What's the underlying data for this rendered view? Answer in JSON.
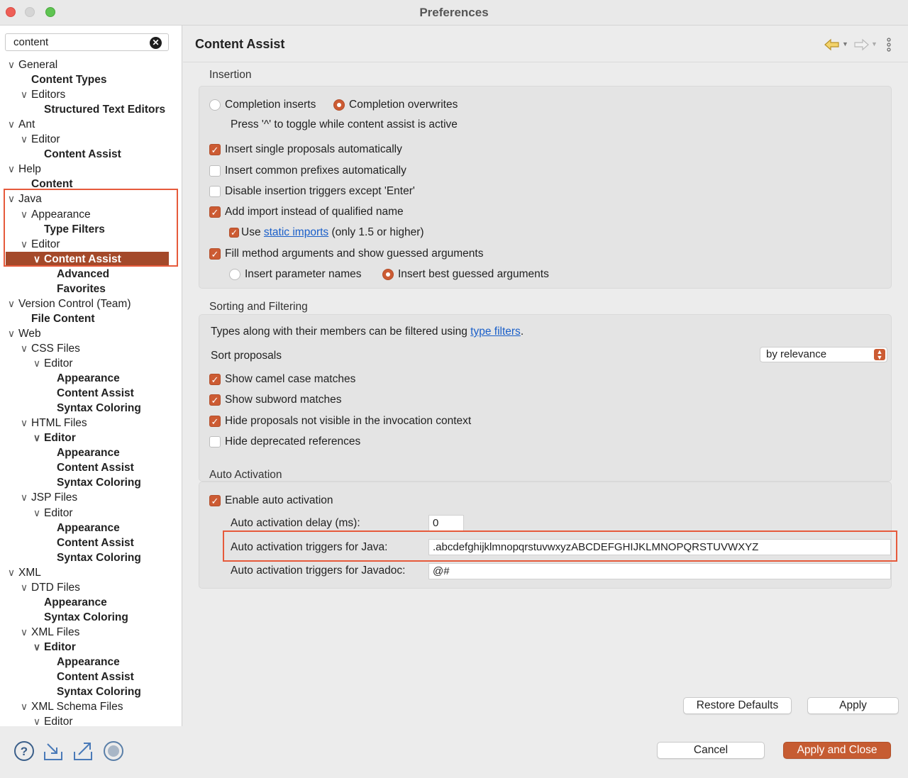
{
  "window": {
    "title": "Preferences"
  },
  "search": {
    "value": "content"
  },
  "tree": [
    {
      "label": "General",
      "level": 0,
      "expanded": true,
      "bold": false
    },
    {
      "label": "Content Types",
      "level": 1,
      "bold": true
    },
    {
      "label": "Editors",
      "level": 1,
      "expanded": true,
      "bold": false
    },
    {
      "label": "Structured Text Editors",
      "level": 2,
      "bold": true
    },
    {
      "label": "Ant",
      "level": 0,
      "expanded": true,
      "bold": false
    },
    {
      "label": "Editor",
      "level": 1,
      "expanded": true,
      "bold": false
    },
    {
      "label": "Content Assist",
      "level": 2,
      "bold": true
    },
    {
      "label": "Help",
      "level": 0,
      "expanded": true,
      "bold": false
    },
    {
      "label": "Content",
      "level": 1,
      "bold": true
    },
    {
      "label": "Java",
      "level": 0,
      "expanded": true,
      "bold": false
    },
    {
      "label": "Appearance",
      "level": 1,
      "expanded": true,
      "bold": false
    },
    {
      "label": "Type Filters",
      "level": 2,
      "bold": true
    },
    {
      "label": "Editor",
      "level": 1,
      "expanded": true,
      "bold": false
    },
    {
      "label": "Content Assist",
      "level": 2,
      "expanded": true,
      "bold": true,
      "selected": true
    },
    {
      "label": "Advanced",
      "level": 3,
      "bold": true
    },
    {
      "label": "Favorites",
      "level": 3,
      "bold": true
    },
    {
      "label": "Version Control (Team)",
      "level": 0,
      "expanded": true,
      "bold": false
    },
    {
      "label": "File Content",
      "level": 1,
      "bold": true
    },
    {
      "label": "Web",
      "level": 0,
      "expanded": true,
      "bold": false
    },
    {
      "label": "CSS Files",
      "level": 1,
      "expanded": true,
      "bold": false
    },
    {
      "label": "Editor",
      "level": 2,
      "expanded": true,
      "bold": false
    },
    {
      "label": "Appearance",
      "level": 3,
      "bold": true
    },
    {
      "label": "Content Assist",
      "level": 3,
      "bold": true
    },
    {
      "label": "Syntax Coloring",
      "level": 3,
      "bold": true
    },
    {
      "label": "HTML Files",
      "level": 1,
      "expanded": true,
      "bold": false
    },
    {
      "label": "Editor",
      "level": 2,
      "expanded": true,
      "bold": true
    },
    {
      "label": "Appearance",
      "level": 3,
      "bold": true
    },
    {
      "label": "Content Assist",
      "level": 3,
      "bold": true
    },
    {
      "label": "Syntax Coloring",
      "level": 3,
      "bold": true
    },
    {
      "label": "JSP Files",
      "level": 1,
      "expanded": true,
      "bold": false
    },
    {
      "label": "Editor",
      "level": 2,
      "expanded": true,
      "bold": false
    },
    {
      "label": "Appearance",
      "level": 3,
      "bold": true
    },
    {
      "label": "Content Assist",
      "level": 3,
      "bold": true
    },
    {
      "label": "Syntax Coloring",
      "level": 3,
      "bold": true
    },
    {
      "label": "XML",
      "level": 0,
      "expanded": true,
      "bold": false
    },
    {
      "label": "DTD Files",
      "level": 1,
      "expanded": true,
      "bold": false
    },
    {
      "label": "Appearance",
      "level": 2,
      "bold": true
    },
    {
      "label": "Syntax Coloring",
      "level": 2,
      "bold": true
    },
    {
      "label": "XML Files",
      "level": 1,
      "expanded": true,
      "bold": false
    },
    {
      "label": "Editor",
      "level": 2,
      "expanded": true,
      "bold": true
    },
    {
      "label": "Appearance",
      "level": 3,
      "bold": true
    },
    {
      "label": "Content Assist",
      "level": 3,
      "bold": true
    },
    {
      "label": "Syntax Coloring",
      "level": 3,
      "bold": true
    },
    {
      "label": "XML Schema Files",
      "level": 1,
      "expanded": true,
      "bold": false
    },
    {
      "label": "Editor",
      "level": 2,
      "expanded": true,
      "bold": false
    }
  ],
  "page": {
    "title": "Content Assist"
  },
  "insertion": {
    "title": "Insertion",
    "completion_inserts": "Completion inserts",
    "completion_overwrites": "Completion overwrites",
    "hint": "Press '^' to toggle while content assist is active",
    "insert_single": "Insert single proposals automatically",
    "insert_common": "Insert common prefixes automatically",
    "disable_triggers": "Disable insertion triggers except 'Enter'",
    "add_import": "Add import instead of qualified name",
    "use_prefix": "Use ",
    "static_imports": "static imports",
    "use_suffix": " (only 1.5 or higher)",
    "fill_method": "Fill method arguments and show guessed arguments",
    "insert_param": "Insert parameter names",
    "insert_best": "Insert best guessed arguments"
  },
  "sorting": {
    "title": "Sorting and Filtering",
    "types_prefix": "Types along with their members can be filtered using ",
    "type_filters": "type filters",
    "types_suffix": ".",
    "sort_label": "Sort proposals",
    "sort_value": "by relevance",
    "camel": "Show camel case matches",
    "subword": "Show subword matches",
    "hide_not_visible": "Hide proposals not visible in the invocation context",
    "hide_deprecated": "Hide deprecated references"
  },
  "auto": {
    "title": "Auto Activation",
    "enable": "Enable auto activation",
    "delay_label": "Auto activation delay (ms):",
    "delay_value": "0",
    "java_label": "Auto activation triggers for Java:",
    "java_value": ".abcdefghijklmnopqrstuvwxyzABCDEFGHIJKLMNOPQRSTUVWXYZ",
    "javadoc_label": "Auto activation triggers for Javadoc:",
    "javadoc_value": "@#"
  },
  "buttons": {
    "restore": "Restore Defaults",
    "apply": "Apply",
    "cancel": "Cancel",
    "apply_close": "Apply and Close"
  },
  "colors": {
    "accent": "#cc5b33",
    "highlight_border": "#e65a3b",
    "selection": "#a4492a",
    "link": "#1a5fc9"
  }
}
